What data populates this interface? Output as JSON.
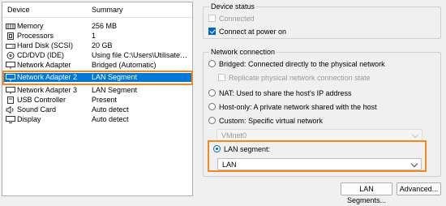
{
  "devices": {
    "col_device": "Device",
    "col_summary": "Summary",
    "rows": [
      {
        "name": "Memory",
        "summary": "256 MB",
        "icon": "memory-icon"
      },
      {
        "name": "Processors",
        "summary": "1",
        "icon": "processor-icon"
      },
      {
        "name": "Hard Disk (SCSI)",
        "summary": "20 GB",
        "icon": "hard-disk-icon"
      },
      {
        "name": "CD/DVD (IDE)",
        "summary": "Using file C:\\Users\\Utilisateur\\...",
        "icon": "cd-icon"
      },
      {
        "name": "Network Adapter",
        "summary": "Bridged (Automatic)",
        "icon": "network-icon"
      },
      {
        "name": "Network Adapter 2",
        "summary": "LAN Segment",
        "icon": "network-icon"
      },
      {
        "name": "Network Adapter 3",
        "summary": "LAN Segment",
        "icon": "network-icon"
      },
      {
        "name": "USB Controller",
        "summary": "Present",
        "icon": "usb-icon"
      },
      {
        "name": "Sound Card",
        "summary": "Auto detect",
        "icon": "speaker-icon"
      },
      {
        "name": "Display",
        "summary": "Auto detect",
        "icon": "display-icon"
      }
    ],
    "selected_index": 5
  },
  "device_status": {
    "title": "Device status",
    "connected": "Connected",
    "connected_checked": false,
    "connect_at_power_on": "Connect at power on",
    "connect_at_power_on_checked": true
  },
  "network_connection": {
    "title": "Network connection",
    "bridged": "Bridged: Connected directly to the physical network",
    "replicate": "Replicate physical network connection state",
    "nat": "NAT: Used to share the host's IP address",
    "host_only": "Host-only: A private network shared with the host",
    "custom": "Custom: Specific virtual network",
    "custom_value": "VMnet0",
    "lan_segment": "LAN segment:",
    "lan_value": "LAN",
    "selected": "lan_segment"
  },
  "buttons": {
    "lan_segments": "LAN Segments...",
    "advanced": "Advanced..."
  },
  "colors": {
    "accent": "#0078d7",
    "highlight": "#f5871f"
  }
}
